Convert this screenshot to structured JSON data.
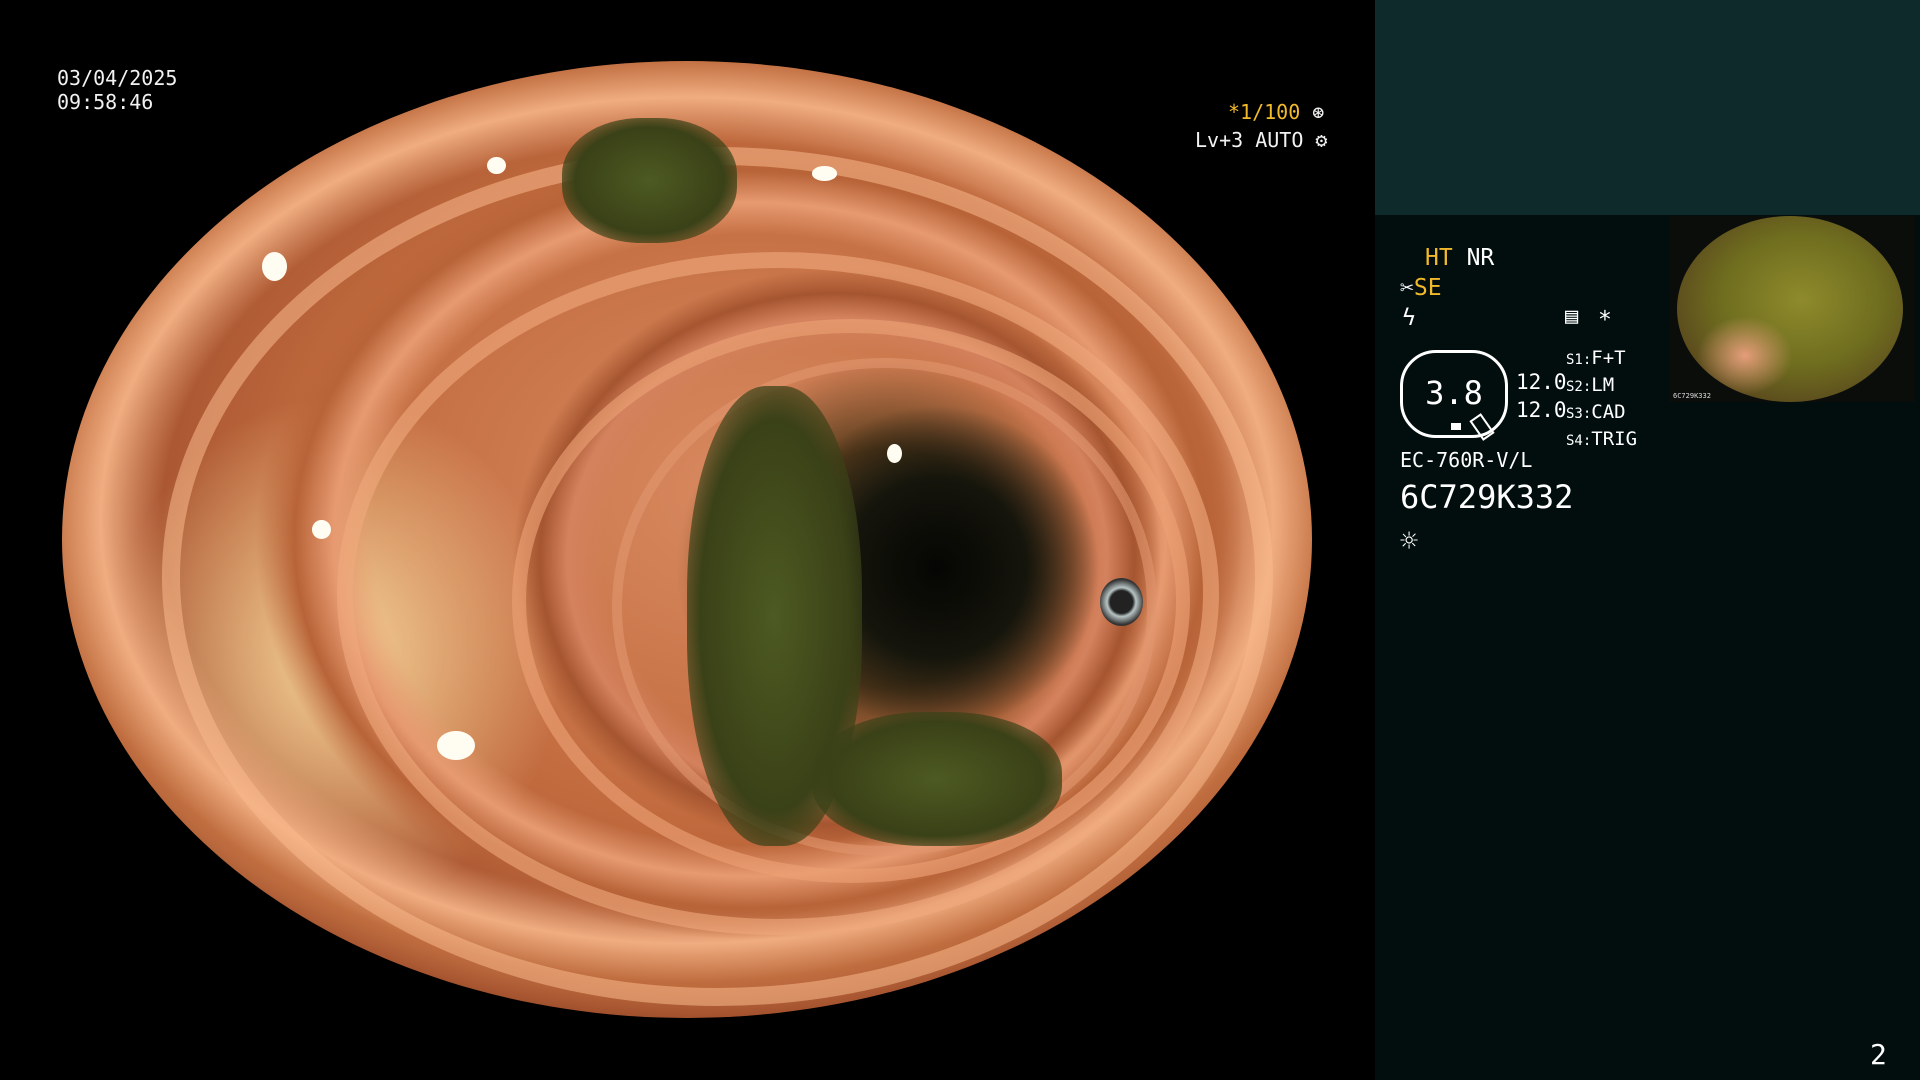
{
  "overlay": {
    "date": "03/04/2025",
    "time": "09:58:46",
    "shutter": "*1/100",
    "shutter_icon": "aperture-icon",
    "level": "Lv+3 AUTO",
    "level_icon": "gear-icon",
    "page_number": "2"
  },
  "panel": {
    "mode_ht": "HT",
    "mode_nr": "NR",
    "mode_se": "SE",
    "scope_value": "3.8",
    "value_a": "12.0",
    "value_b": "12.0",
    "s1_key": "S1:",
    "s1_val": "F+T",
    "s2_key": "S2:",
    "s2_val": "LM",
    "s3_key": "S3:",
    "s3_val": "CAD",
    "s4_key": "S4:",
    "s4_val": "TRIG",
    "asterisk": "*",
    "scope_model": "EC-760R-V/L",
    "serial": "6C729K332",
    "thumb_label": "6C729K332"
  },
  "colors": {
    "accent_yellow": "#f2b92b",
    "panel_bg": "#020e0e",
    "panel_top_bg": "#0f2a2a"
  },
  "icons": [
    "aperture-icon",
    "gear-icon",
    "scissors-icon",
    "lightning-icon",
    "document-icon",
    "brightness-icon"
  ]
}
